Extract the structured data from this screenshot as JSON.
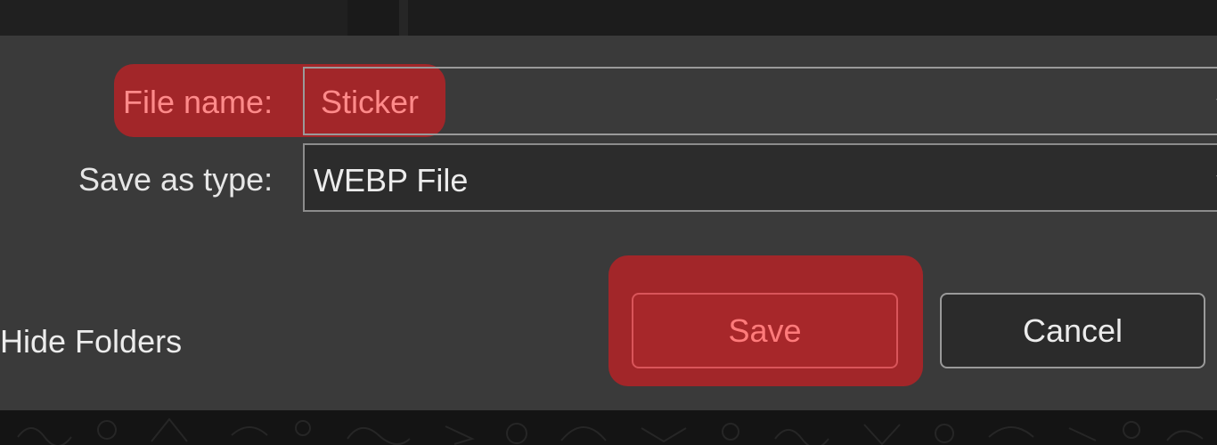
{
  "dialog": {
    "file_name_label": "File name:",
    "file_name_value": "Sticker",
    "save_as_type_label": "Save as type:",
    "save_as_type_value": "WEBP File",
    "hide_folders_label": "Hide Folders",
    "save_label": "Save",
    "cancel_label": "Cancel"
  },
  "icons": {
    "dropdown": "chevron-down-icon"
  },
  "colors": {
    "dialog_bg": "#3a3a3a",
    "highlight": "#ba2226",
    "field_bg": "#2c2c2c",
    "text": "#ececec"
  }
}
